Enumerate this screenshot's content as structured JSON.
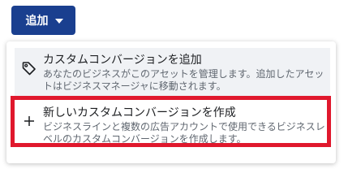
{
  "add_button": {
    "label": "追加"
  },
  "menu": {
    "items": [
      {
        "icon": "tag-icon",
        "title": "カスタムコンバージョンを追加",
        "description": "あなたのビジネスがこのアセットを管理します。追加したアセットはビジネスマネージャに移動されます。"
      },
      {
        "icon": "plus-icon",
        "title": "新しいカスタムコンバージョンを作成",
        "description": "ビジネスラインと複数の広告アカウントで使用できるビジネスレベルのカスタムコンバージョンを作成します。"
      }
    ]
  },
  "colors": {
    "button_bg": "#1a3f8f",
    "highlight_border": "#e0182d",
    "hover_bg": "#f0f2f5"
  }
}
